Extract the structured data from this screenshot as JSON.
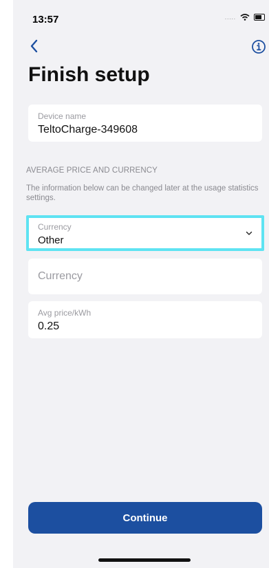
{
  "status_bar": {
    "time": "13:57",
    "signal": "....."
  },
  "nav": {
    "back_icon": "chevron-left-icon",
    "info_icon": "info-icon"
  },
  "page": {
    "title": "Finish setup"
  },
  "device": {
    "label": "Device name",
    "value": "TeltoCharge-349608"
  },
  "section": {
    "header": "AVERAGE PRICE AND CURRENCY",
    "help": "The information below can be changed later at the usage statistics settings."
  },
  "currency_select": {
    "label": "Currency",
    "value": "Other"
  },
  "currency_input": {
    "placeholder": "Currency",
    "value": ""
  },
  "price": {
    "label": "Avg price/kWh",
    "value": "0.25"
  },
  "actions": {
    "continue_label": "Continue"
  },
  "colors": {
    "accent": "#1c4fa0",
    "focus_outline": "#5ee3f2",
    "background": "#f2f2f5"
  }
}
